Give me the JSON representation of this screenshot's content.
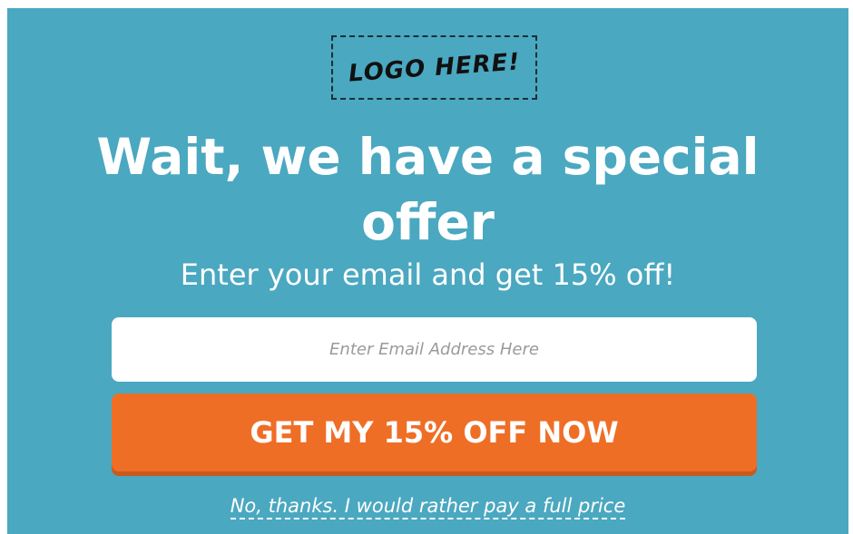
{
  "logo": {
    "text": "LOGO HERE!"
  },
  "headline": "Wait, we have a special offer",
  "subheadline": "Enter your email and get 15% off!",
  "form": {
    "email_placeholder": "Enter Email Address Here",
    "email_value": "",
    "submit_label": "GET MY 15% OFF NOW"
  },
  "decline_label": "No, thanks. I would rather pay a full price",
  "colors": {
    "background": "#4aa8c0",
    "button": "#ef6e26",
    "text": "#ffffff"
  }
}
